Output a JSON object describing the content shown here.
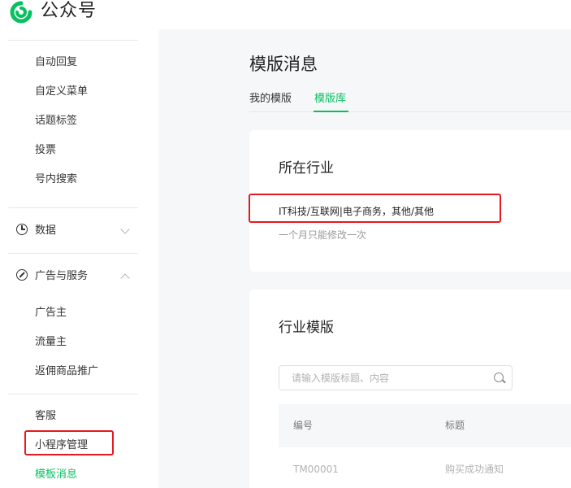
{
  "header": {
    "brand": "公众号"
  },
  "sidebar": {
    "items_top": [
      "自动回复",
      "自定义菜单",
      "话题标签",
      "投票",
      "号内搜索"
    ],
    "group_data": "数据",
    "group_ads": "广告与服务",
    "items_ads": [
      "广告主",
      "流量主",
      "返佣商品推广"
    ],
    "items_bottom": [
      "客服",
      "小程序管理"
    ],
    "active_item": "模板消息"
  },
  "main": {
    "title": "模版消息",
    "tabs": [
      "我的模版",
      "模版库"
    ],
    "industry_card": {
      "title": "所在行业",
      "industry": "IT科技/互联网|电子商务，其他/其他",
      "hint": "一个月只能修改一次"
    },
    "template_card": {
      "title": "行业模版",
      "search_placeholder": "请输入模版标题、内容",
      "columns": [
        "编号",
        "标题"
      ],
      "rows": [
        [
          "TM00001",
          "购买成功通知"
        ]
      ]
    }
  },
  "colors": {
    "accent": "#07c160",
    "highlight_box": "#e5191e"
  }
}
